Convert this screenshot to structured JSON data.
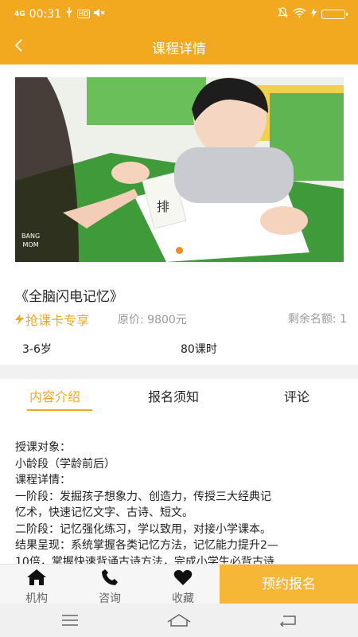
{
  "status_bar": {
    "network": "4G",
    "time": "00:31",
    "hd_badge": "HD"
  },
  "nav": {
    "title": "课程详情"
  },
  "banner": {
    "watermark_line1": "BANG",
    "watermark_line2": "MOM",
    "slide_count": 3,
    "active_slide": 2
  },
  "course": {
    "title": "《全脑闪电记忆》",
    "promo": "抢课卡专享",
    "original_price": "原价: 9800元",
    "remaining": "剩余名额: 1",
    "age": "3-6岁",
    "hours": "80课时"
  },
  "tabs": [
    "内容介绍",
    "报名须知",
    "评论"
  ],
  "content": {
    "lines": [
      "授课对象：",
      "小龄段（学龄前后）",
      "课程详情：",
      "一阶段：发掘孩子想象力、创造力，传授三大经典记",
      "忆术，快速记忆文字、古诗、短文。",
      "二阶段：记忆强化练习，学以致用，对接小学课本。",
      "结果呈现：系统掌握各类记忆方法，记忆能力提升2—",
      "10倍，掌握快速背诵古诗方法，完成小学生必背古诗"
    ]
  },
  "bottom_bar": {
    "org_label": "机构",
    "consult_label": "咨询",
    "favorite_label": "收藏",
    "enroll_label": "预约报名"
  },
  "colors": {
    "brand": "#f2a91f",
    "enroll": "#f5b735",
    "active_dot": "#f28c1c"
  }
}
